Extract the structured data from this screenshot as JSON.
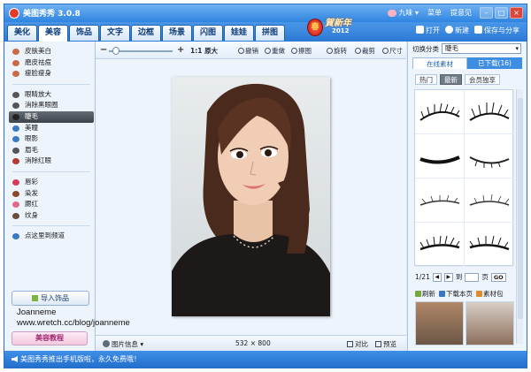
{
  "app": {
    "title": "美图秀秀 3.0.8",
    "user": "九味",
    "menu": "菜单",
    "feedback": "提意见",
    "banner_text": "賀新年",
    "banner_year": "2012"
  },
  "top_actions": {
    "open": "打开",
    "new": "新建",
    "save_share": "保存与分享"
  },
  "tabs": [
    "美化",
    "美容",
    "饰品",
    "文字",
    "边框",
    "场景",
    "闪图",
    "娃娃",
    "拼图"
  ],
  "active_tab": "美容",
  "left_menu": {
    "group1": [
      "皮肤美白",
      "磨皮祛痘",
      "瘦脸瘦身"
    ],
    "group2": [
      "眼睛放大",
      "消除黑眼圈",
      "睫毛",
      "美瞳",
      "眼影",
      "眉毛",
      "消除红眼"
    ],
    "group3": [
      "唇彩",
      "染发",
      "腮红",
      "纹身"
    ],
    "group4": [
      "点这里到频道"
    ],
    "active_item": "睫毛"
  },
  "import_label": "导入饰品",
  "tutorial_label": "美容教程",
  "watermark": {
    "line1": "Joanneme",
    "line2": "www.wretch.cc/blog/joanneme"
  },
  "toolbar": {
    "zoom_minus": "−",
    "zoom_plus": "+",
    "zoom_level": 0.05,
    "ratio_label": "1:1",
    "original_label": "原大",
    "undo": "撤销",
    "redo": "重做",
    "eraser": "擦图",
    "rotate": "旋转",
    "crop": "裁剪",
    "size": "尺寸"
  },
  "status": {
    "image_info": "图片信息",
    "width": "532",
    "times": "×",
    "height": "800",
    "compare": "对比",
    "preview": "预览"
  },
  "right_panel": {
    "category_label": "切换分类",
    "category_value": "睫毛",
    "online_tab": "在线素材",
    "downloaded_tab": "已下载(16)",
    "subtabs": [
      "热门",
      "最新",
      "会员独享"
    ],
    "active_subtab": "最新",
    "page_current": "1/21",
    "goto_label": "到",
    "page_unit": "页",
    "go_label": "GO",
    "refresh": "刷新",
    "download_page": "下载本页",
    "material_pack": "素材包"
  },
  "bottom_message": "美图秀秀推出手机版啦，永久免费哦！",
  "colors": {
    "title_blue": "#2e84e0",
    "panel_bg": "#eef4fc",
    "active_menu": "#4a5159",
    "close_red": "#d9473b"
  },
  "icons": [
    "app-logo-icon",
    "pig-icon",
    "minimize-icon",
    "maximize-icon",
    "close-icon",
    "open-icon",
    "new-icon",
    "save-icon",
    "undo-icon",
    "redo-icon",
    "eraser-icon",
    "rotate-icon",
    "crop-icon",
    "size-icon",
    "info-icon",
    "compare-icon",
    "preview-icon",
    "refresh-icon",
    "download-icon",
    "package-icon",
    "speaker-icon"
  ]
}
